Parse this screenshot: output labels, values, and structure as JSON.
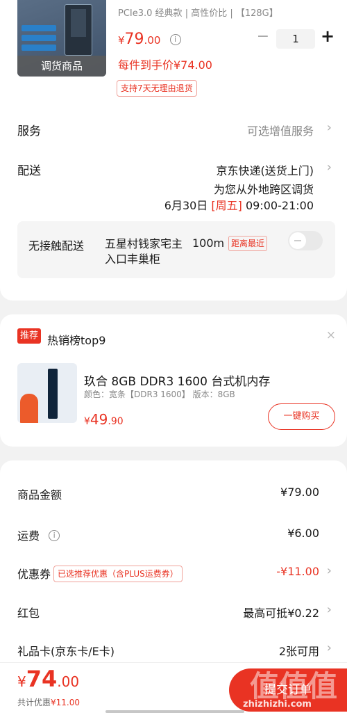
{
  "colors": {
    "accent": "#e93323",
    "muted": "#888888",
    "background": "#f2f2f2"
  },
  "product": {
    "image_caption": "调货商品",
    "specs": "PCIe3.0  经典款 | 高性价比 | 【128G】",
    "price_symbol": "¥",
    "price_integer": "79",
    "price_cents": ".00",
    "info_icon": "i",
    "quantity": "1",
    "minus": "−",
    "plus": "+",
    "hand_price": "每件到手价¥74.00",
    "return_policy": "支持7天无理由退货"
  },
  "service": {
    "label": "服务",
    "value": "可选增值服务"
  },
  "delivery": {
    "label": "配送",
    "method": "京东快递(送货上门)",
    "note": "为您从外地跨区调货",
    "date": "6月30日",
    "weekday": "[周五]",
    "time": "09:00-21:00"
  },
  "contactless": {
    "title": "无接触配送",
    "address": "五星村钱家宅主入口丰巢柜",
    "distance": "100m",
    "badge": "距离最近",
    "enabled": false
  },
  "recommendation": {
    "badge": "推荐",
    "title": "热销榜top9",
    "close": "×",
    "name": "玖合  8GB  DDR3  1600  台式机内存",
    "spec": "颜色：宽条【DDR3 1600】   版本：8GB",
    "price_symbol": "¥",
    "price_integer": "49",
    "price_cents": ".90",
    "button": "一键购买"
  },
  "summary": {
    "goods_amount": {
      "label": "商品金额",
      "value": "¥79.00"
    },
    "shipping": {
      "label": "运费",
      "value": "¥6.00"
    },
    "coupon": {
      "label": "优惠券",
      "badge": "已选推荐优惠（含PLUS运费券）",
      "value": "-¥11.00"
    },
    "red_packet": {
      "label": "红包",
      "value": "最高可抵¥0.22"
    },
    "gift_card": {
      "label": "礼品卡(京东卡/E卡)",
      "value": "2张可用"
    }
  },
  "footer": {
    "total_symbol": "¥",
    "total_integer": "74",
    "total_cents": ".00",
    "saved_label": "共计优惠",
    "saved_value": "¥11.00",
    "submit": "提交订单"
  },
  "watermark": {
    "text": "值值值",
    "url": "zhizhizhi.com"
  },
  "chevron": "›"
}
